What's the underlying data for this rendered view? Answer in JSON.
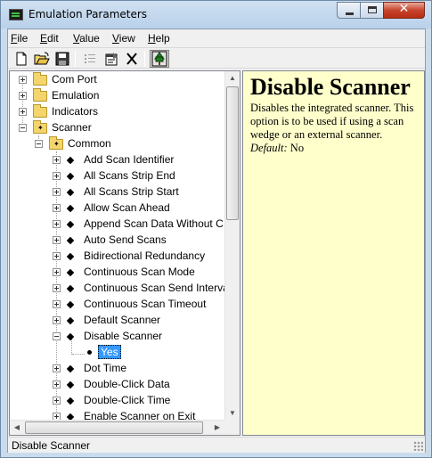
{
  "window": {
    "title": "Emulation Parameters"
  },
  "menu": [
    {
      "label": "File",
      "accel": "F",
      "rest": "ile"
    },
    {
      "label": "Edit",
      "accel": "E",
      "rest": "dit"
    },
    {
      "label": "Value",
      "accel": "V",
      "rest": "alue"
    },
    {
      "label": "View",
      "accel": "V",
      "rest": "iew"
    },
    {
      "label": "Help",
      "accel": "H",
      "rest": "elp"
    }
  ],
  "toolbar": {
    "buttons": [
      "new-document-icon",
      "open-folder-icon",
      "save-disk-icon",
      "list-icon",
      "properties-icon",
      "delete-icon",
      "tree-icon"
    ]
  },
  "tree": {
    "top_folders": [
      "Com Port",
      "Emulation",
      "Indicators",
      "Scanner"
    ],
    "subfolder": "Common",
    "items": [
      "Add Scan Identifier",
      "All Scans Strip End",
      "All Scans Strip Start",
      "Allow Scan Ahead",
      "Append Scan Data Without C",
      "Auto Send Scans",
      "Bidirectional Redundancy",
      "Continuous Scan Mode",
      "Continuous Scan Send Interva",
      "Continuous Scan Timeout",
      "Default Scanner",
      "Disable Scanner",
      "Dot Time",
      "Double-Click Data",
      "Double-Click Time",
      "Enable Scanner on Exit"
    ],
    "selected_child": "Yes"
  },
  "description": {
    "title": "Disable Scanner",
    "body": "Disables the integrated scanner. This option is to be used if using a scan wedge or an external scanner.",
    "default_label": "Default:",
    "default_value": "No"
  },
  "status": {
    "text": "Disable Scanner"
  },
  "colors": {
    "description_bg": "#ffffcc",
    "selection": "#3399ff"
  }
}
